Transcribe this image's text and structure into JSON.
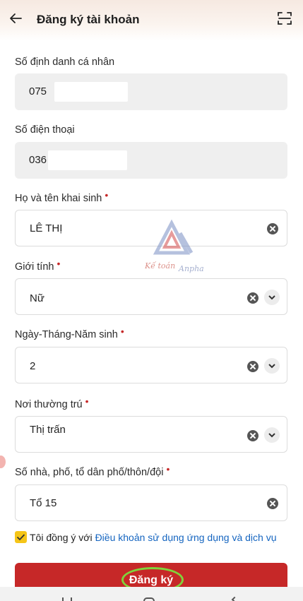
{
  "header": {
    "title": "Đăng ký tài khoản"
  },
  "fields": {
    "id_number": {
      "label": "Số định danh cá nhân",
      "value": "075",
      "required": false
    },
    "phone": {
      "label": "Số điện thoại",
      "value": "036",
      "required": false
    },
    "full_name": {
      "label": "Họ và tên khai sinh",
      "value": "LÊ THỊ",
      "required": true
    },
    "gender": {
      "label": "Giới tính",
      "value": "Nữ",
      "required": true
    },
    "dob": {
      "label": "Ngày-Tháng-Năm sinh",
      "value": "2",
      "required": true
    },
    "residence": {
      "label": "Nơi thường trú",
      "value": "Thị trấn",
      "required": true
    },
    "address": {
      "label": "Số nhà, phố, tổ dân phố/thôn/đội",
      "value": "Tổ 15",
      "required": true
    }
  },
  "required_mark": "•",
  "agreement": {
    "text": "Tôi đồng ý với",
    "link": "Điều khoản sử dụng ứng dụng và dịch vụ",
    "checked": true
  },
  "submit_label": "Đăng ký",
  "watermark": {
    "line1": "Kế toán",
    "line2": "Anpha"
  },
  "icons": {
    "back": "arrow-left-icon",
    "scan": "qr-scan-icon",
    "clear": "clear-icon",
    "dropdown": "chevron-down-icon"
  },
  "colors": {
    "primary": "#c62828",
    "link": "#1565c0",
    "checkbox": "#f5c518",
    "highlight_ring": "#7fd33b"
  }
}
